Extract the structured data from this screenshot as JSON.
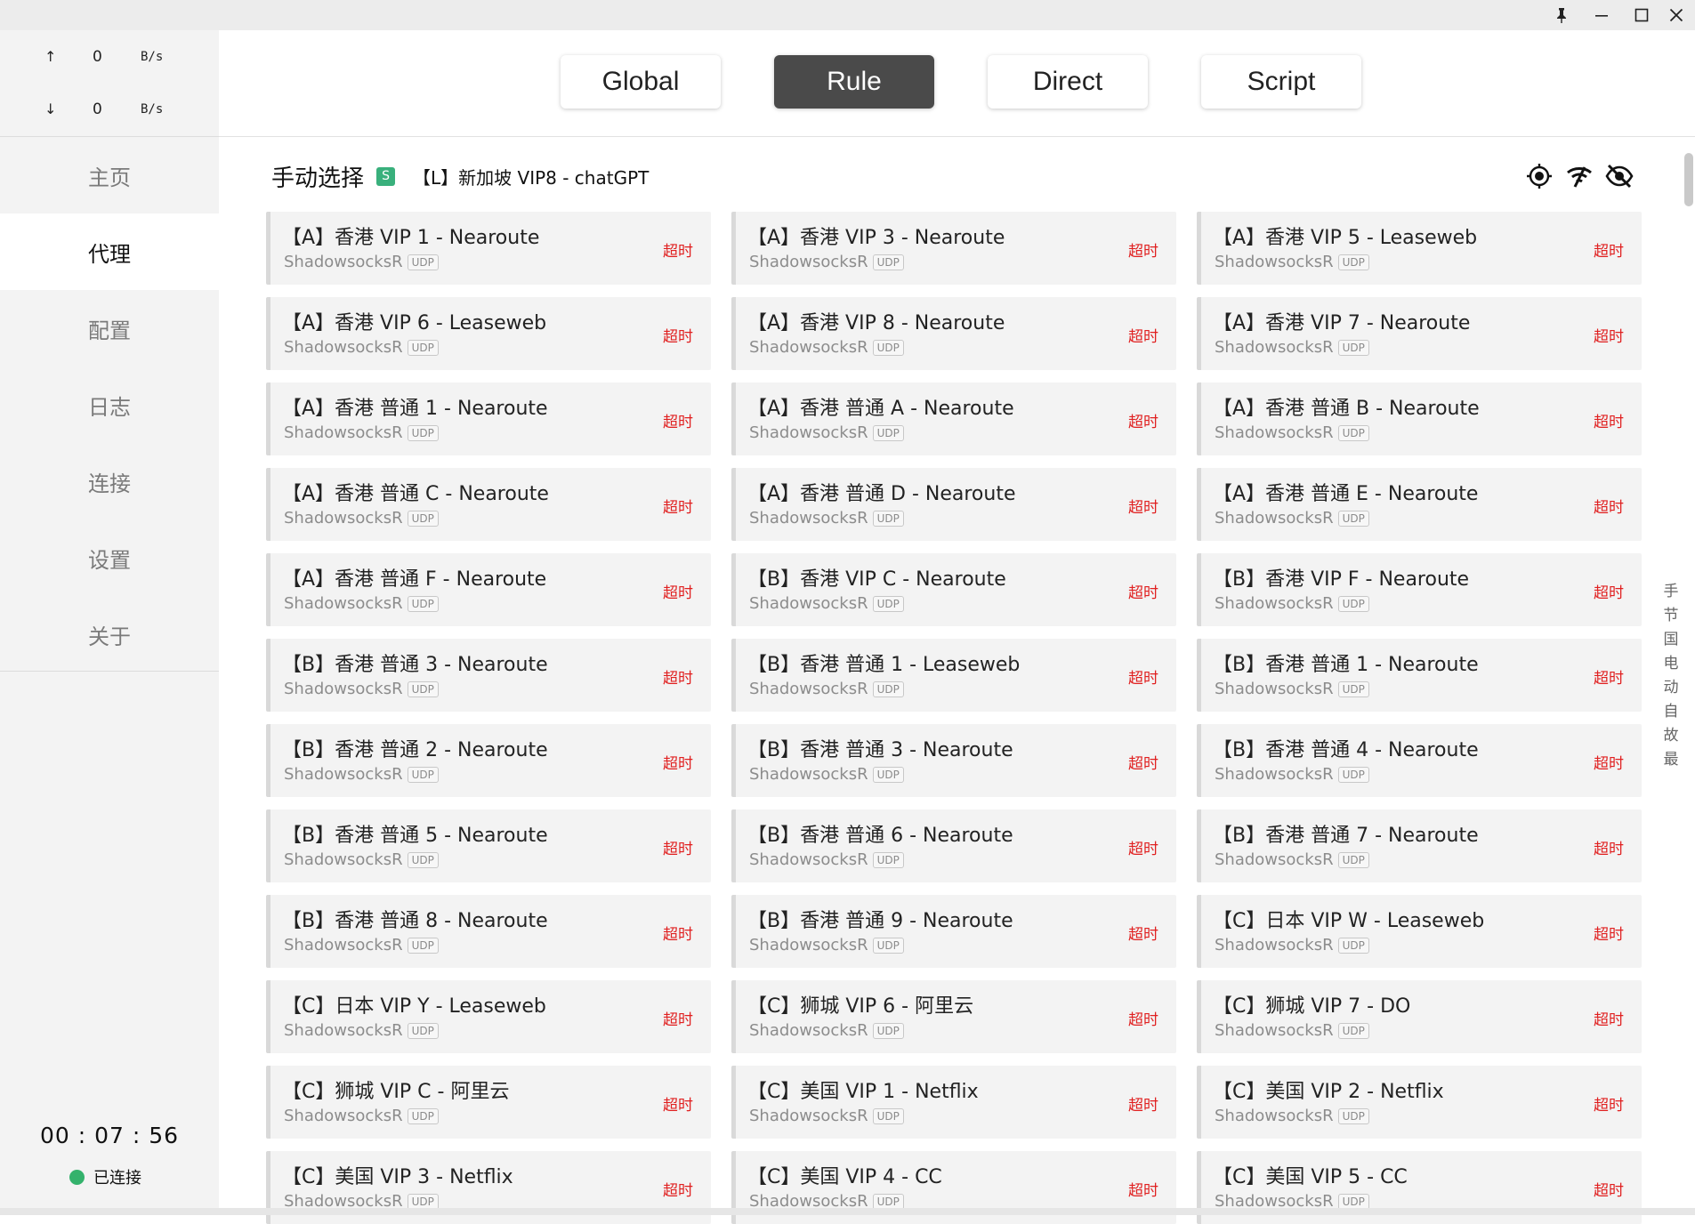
{
  "window": {
    "controls": {
      "pin": "pin-icon",
      "minimize": "minimize-icon",
      "maximize": "maximize-icon",
      "close": "close-icon"
    }
  },
  "traffic": {
    "up": {
      "arrow": "↑",
      "value": "0",
      "unit": "B/s"
    },
    "down": {
      "arrow": "↓",
      "value": "0",
      "unit": "B/s"
    }
  },
  "nav": {
    "items": [
      {
        "label": "主页",
        "active": false
      },
      {
        "label": "代理",
        "active": true
      },
      {
        "label": "配置",
        "active": false
      },
      {
        "label": "日志",
        "active": false
      },
      {
        "label": "连接",
        "active": false
      },
      {
        "label": "设置",
        "active": false
      },
      {
        "label": "关于",
        "active": false
      }
    ]
  },
  "status": {
    "uptime": "00 : 07 : 56",
    "connection": "已连接",
    "connection_color": "#34b26c"
  },
  "modes": {
    "items": [
      {
        "label": "Global",
        "active": false
      },
      {
        "label": "Rule",
        "active": true
      },
      {
        "label": "Direct",
        "active": false
      },
      {
        "label": "Script",
        "active": false
      }
    ]
  },
  "group": {
    "title": "手动选择",
    "badge": "S",
    "selected": "【L】新加坡 VIP8 - chatGPT",
    "icons": [
      "locate-icon",
      "wifi-test-icon",
      "hide-icon"
    ]
  },
  "colors": {
    "accent": "#4a4a4a",
    "timeout": "#e02020",
    "badge": "#39b07c"
  },
  "proxies": [
    {
      "name": "【A】香港 VIP 1 - Nearoute",
      "type": "ShadowsocksR",
      "udp": "UDP",
      "delay": "超时"
    },
    {
      "name": "【A】香港 VIP 3 - Nearoute",
      "type": "ShadowsocksR",
      "udp": "UDP",
      "delay": "超时"
    },
    {
      "name": "【A】香港 VIP 5 - Leaseweb",
      "type": "ShadowsocksR",
      "udp": "UDP",
      "delay": "超时"
    },
    {
      "name": "【A】香港 VIP 6 - Leaseweb",
      "type": "ShadowsocksR",
      "udp": "UDP",
      "delay": "超时"
    },
    {
      "name": "【A】香港 VIP 8 - Nearoute",
      "type": "ShadowsocksR",
      "udp": "UDP",
      "delay": "超时"
    },
    {
      "name": "【A】香港 VIP 7 - Nearoute",
      "type": "ShadowsocksR",
      "udp": "UDP",
      "delay": "超时"
    },
    {
      "name": "【A】香港 普通 1 - Nearoute",
      "type": "ShadowsocksR",
      "udp": "UDP",
      "delay": "超时"
    },
    {
      "name": "【A】香港 普通 A - Nearoute",
      "type": "ShadowsocksR",
      "udp": "UDP",
      "delay": "超时"
    },
    {
      "name": "【A】香港 普通 B - Nearoute",
      "type": "ShadowsocksR",
      "udp": "UDP",
      "delay": "超时"
    },
    {
      "name": "【A】香港 普通 C - Nearoute",
      "type": "ShadowsocksR",
      "udp": "UDP",
      "delay": "超时"
    },
    {
      "name": "【A】香港 普通 D - Nearoute",
      "type": "ShadowsocksR",
      "udp": "UDP",
      "delay": "超时"
    },
    {
      "name": "【A】香港 普通 E - Nearoute",
      "type": "ShadowsocksR",
      "udp": "UDP",
      "delay": "超时"
    },
    {
      "name": "【A】香港 普通 F - Nearoute",
      "type": "ShadowsocksR",
      "udp": "UDP",
      "delay": "超时"
    },
    {
      "name": "【B】香港 VIP C - Nearoute",
      "type": "ShadowsocksR",
      "udp": "UDP",
      "delay": "超时"
    },
    {
      "name": "【B】香港 VIP F - Nearoute",
      "type": "ShadowsocksR",
      "udp": "UDP",
      "delay": "超时"
    },
    {
      "name": "【B】香港 普通 3 - Nearoute",
      "type": "ShadowsocksR",
      "udp": "UDP",
      "delay": "超时"
    },
    {
      "name": "【B】香港 普通 1 - Leaseweb",
      "type": "ShadowsocksR",
      "udp": "UDP",
      "delay": "超时"
    },
    {
      "name": "【B】香港 普通 1 - Nearoute",
      "type": "ShadowsocksR",
      "udp": "UDP",
      "delay": "超时"
    },
    {
      "name": "【B】香港 普通 2 - Nearoute",
      "type": "ShadowsocksR",
      "udp": "UDP",
      "delay": "超时"
    },
    {
      "name": "【B】香港 普通 3 - Nearoute",
      "type": "ShadowsocksR",
      "udp": "UDP",
      "delay": "超时"
    },
    {
      "name": "【B】香港 普通 4 - Nearoute",
      "type": "ShadowsocksR",
      "udp": "UDP",
      "delay": "超时"
    },
    {
      "name": "【B】香港 普通 5 - Nearoute",
      "type": "ShadowsocksR",
      "udp": "UDP",
      "delay": "超时"
    },
    {
      "name": "【B】香港 普通 6 - Nearoute",
      "type": "ShadowsocksR",
      "udp": "UDP",
      "delay": "超时"
    },
    {
      "name": "【B】香港 普通 7 - Nearoute",
      "type": "ShadowsocksR",
      "udp": "UDP",
      "delay": "超时"
    },
    {
      "name": "【B】香港 普通 8 - Nearoute",
      "type": "ShadowsocksR",
      "udp": "UDP",
      "delay": "超时"
    },
    {
      "name": "【B】香港 普通 9 - Nearoute",
      "type": "ShadowsocksR",
      "udp": "UDP",
      "delay": "超时"
    },
    {
      "name": "【C】日本 VIP W - Leaseweb",
      "type": "ShadowsocksR",
      "udp": "UDP",
      "delay": "超时"
    },
    {
      "name": "【C】日本 VIP Y - Leaseweb",
      "type": "ShadowsocksR",
      "udp": "UDP",
      "delay": "超时"
    },
    {
      "name": "【C】狮城 VIP 6 - 阿里云",
      "type": "ShadowsocksR",
      "udp": "UDP",
      "delay": "超时"
    },
    {
      "name": "【C】狮城 VIP 7 - DO",
      "type": "ShadowsocksR",
      "udp": "UDP",
      "delay": "超时"
    },
    {
      "name": "【C】狮城 VIP C - 阿里云",
      "type": "ShadowsocksR",
      "udp": "UDP",
      "delay": "超时"
    },
    {
      "name": "【C】美国 VIP 1 - Netflix",
      "type": "ShadowsocksR",
      "udp": "UDP",
      "delay": "超时"
    },
    {
      "name": "【C】美国 VIP 2 - Netflix",
      "type": "ShadowsocksR",
      "udp": "UDP",
      "delay": "超时"
    },
    {
      "name": "【C】美国 VIP 3 - Netflix",
      "type": "ShadowsocksR",
      "udp": "UDP",
      "delay": "超时"
    },
    {
      "name": "【C】美国 VIP 4 - CC",
      "type": "ShadowsocksR",
      "udp": "UDP",
      "delay": "超时"
    },
    {
      "name": "【C】美国 VIP 5 - CC",
      "type": "ShadowsocksR",
      "udp": "UDP",
      "delay": "超时"
    }
  ],
  "index_bar": [
    "手",
    "节",
    "国",
    "电",
    "动",
    "自",
    "故",
    "最"
  ]
}
